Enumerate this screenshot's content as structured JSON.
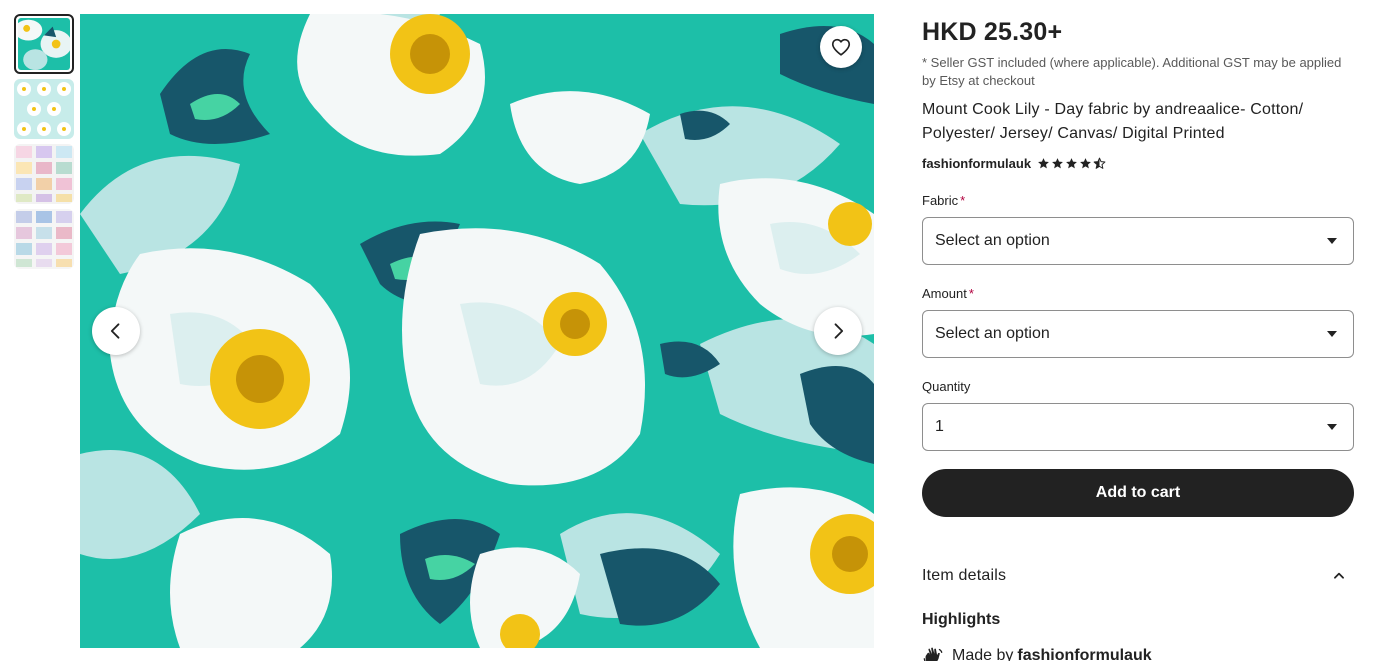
{
  "gallery": {
    "thumbnails": [
      {
        "alt": "teal floral thumbnail",
        "active": true
      },
      {
        "alt": "mint pattern thumbnail",
        "active": false
      },
      {
        "alt": "fabric colour grid thumbnail",
        "active": false
      },
      {
        "alt": "fabric swatch grid thumbnail",
        "active": false
      }
    ],
    "colors": {
      "teal": "#1dbfa8",
      "dark_teal": "#17566a",
      "pale": "#b9e4e3",
      "white": "#f4f8f8",
      "yellow": "#f2c316"
    }
  },
  "product": {
    "price": "HKD 25.30+",
    "tax_note": "* Seller GST included (where applicable). Additional GST may be applied by Etsy at checkout",
    "title": "Mount Cook Lily - Day fabric by andreaalice- Cotton/ Polyester/ Jersey/ Canvas/ Digital Printed",
    "seller": "fashionformulauk",
    "rating": 4.5
  },
  "form": {
    "fabric": {
      "label": "Fabric",
      "required_mark": "*",
      "value": "Select an option"
    },
    "amount": {
      "label": "Amount",
      "required_mark": "*",
      "value": "Select an option"
    },
    "quantity": {
      "label": "Quantity",
      "value": "1"
    },
    "add_to_cart": "Add to cart"
  },
  "details": {
    "section_title": "Item details",
    "highlights_title": "Highlights",
    "made_by_prefix": "Made by",
    "made_by_name": "fashionformulauk"
  }
}
